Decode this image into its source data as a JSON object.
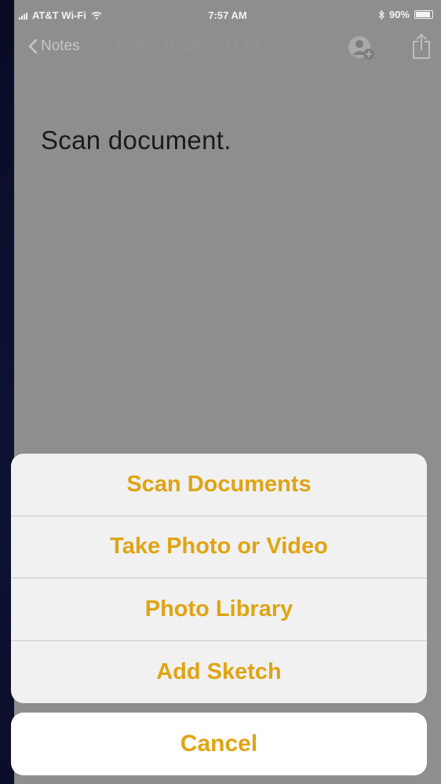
{
  "status_bar": {
    "carrier": "AT&T Wi-Fi",
    "time": "7:57 AM",
    "battery": "90%",
    "battery_level": 0.9
  },
  "nav": {
    "back_label": "Notes",
    "ghost_title": "Notes 10/24/2017 07"
  },
  "note": {
    "body_text": "Scan document."
  },
  "action_sheet": {
    "items": [
      {
        "label": "Scan Documents"
      },
      {
        "label": "Take Photo or Video"
      },
      {
        "label": "Photo Library"
      },
      {
        "label": "Add Sketch"
      }
    ],
    "cancel_label": "Cancel",
    "accent_color": "#e0a412"
  }
}
